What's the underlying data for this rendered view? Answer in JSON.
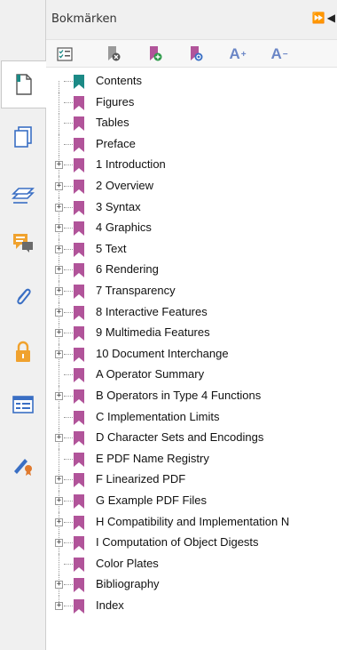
{
  "panel": {
    "title": "Bokmärken",
    "header_controls": "⏩◀"
  },
  "toolbar": {
    "increase_font_label": "A",
    "decrease_font_label": "A",
    "plus_mark": "+",
    "minus_mark": "−"
  },
  "colors": {
    "bookmark_purple": "#b1549a",
    "bookmark_teal": "#1c8a86",
    "accent_blue": "#3a6fc4"
  },
  "bookmarks": [
    {
      "label": "Contents",
      "expandable": false,
      "selected": true
    },
    {
      "label": "Figures",
      "expandable": false
    },
    {
      "label": "Tables",
      "expandable": false
    },
    {
      "label": "Preface",
      "expandable": false
    },
    {
      "label": "1 Introduction",
      "expandable": true
    },
    {
      "label": "2 Overview",
      "expandable": true
    },
    {
      "label": "3 Syntax",
      "expandable": true
    },
    {
      "label": "4 Graphics",
      "expandable": true
    },
    {
      "label": "5 Text",
      "expandable": true
    },
    {
      "label": "6 Rendering",
      "expandable": true
    },
    {
      "label": "7 Transparency",
      "expandable": true
    },
    {
      "label": "8 Interactive Features",
      "expandable": true
    },
    {
      "label": "9 Multimedia Features",
      "expandable": true
    },
    {
      "label": "10 Document Interchange",
      "expandable": true
    },
    {
      "label": "A Operator Summary",
      "expandable": false
    },
    {
      "label": "B Operators in Type 4 Functions",
      "expandable": true
    },
    {
      "label": "C Implementation Limits",
      "expandable": false
    },
    {
      "label": "D Character Sets and Encodings",
      "expandable": true
    },
    {
      "label": "E PDF Name Registry",
      "expandable": false
    },
    {
      "label": "F Linearized PDF",
      "expandable": true
    },
    {
      "label": "G Example PDF Files",
      "expandable": true
    },
    {
      "label": "H Compatibility and Implementation N",
      "expandable": true
    },
    {
      "label": "I Computation of Object Digests",
      "expandable": true
    },
    {
      "label": "Color Plates",
      "expandable": false
    },
    {
      "label": "Bibliography",
      "expandable": true
    },
    {
      "label": "Index",
      "expandable": true
    }
  ]
}
